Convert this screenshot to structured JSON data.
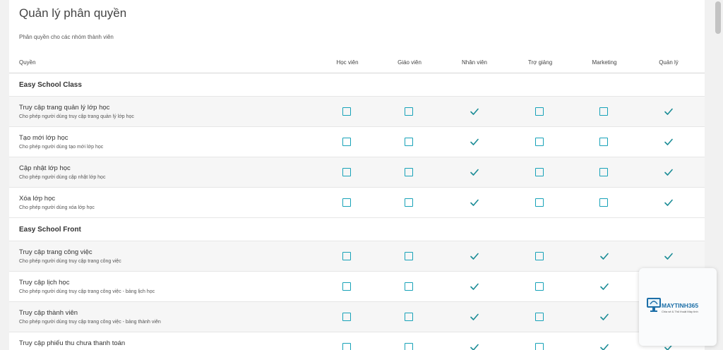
{
  "page": {
    "title": "Quản lý phân quyền",
    "subtitle": "Phân quyền cho các nhóm thành viên"
  },
  "table": {
    "permission_column": "Quyền",
    "roles": [
      "Học viên",
      "Giáo viên",
      "Nhân viên",
      "Trợ giảng",
      "Marketing",
      "Quản lý"
    ],
    "sections": [
      {
        "name": "Easy School Class",
        "items": [
          {
            "title": "Truy cập trang quản lý lớp học",
            "description": "Cho phép người dùng truy cập trang quản lý lớp học",
            "permissions": [
              false,
              false,
              true,
              false,
              false,
              true
            ]
          },
          {
            "title": "Tạo mới lớp học",
            "description": "Cho phép người dùng tạo mới lớp học",
            "permissions": [
              false,
              false,
              true,
              false,
              false,
              true
            ]
          },
          {
            "title": "Cập nhật lớp học",
            "description": "Cho phép người dùng cập nhật lớp học",
            "permissions": [
              false,
              false,
              true,
              false,
              false,
              true
            ]
          },
          {
            "title": "Xóa lớp học",
            "description": "Cho phép người dùng xóa lớp học",
            "permissions": [
              false,
              false,
              true,
              false,
              false,
              true
            ]
          }
        ]
      },
      {
        "name": "Easy School Front",
        "items": [
          {
            "title": "Truy cập trang công việc",
            "description": "Cho phép người dùng truy cập trang công việc",
            "permissions": [
              false,
              false,
              true,
              false,
              true,
              true
            ]
          },
          {
            "title": "Truy cập lịch học",
            "description": "Cho phép người dùng truy cập trang công việc - bảng lịch học",
            "permissions": [
              false,
              false,
              true,
              false,
              true,
              true
            ]
          },
          {
            "title": "Truy cập thành viên",
            "description": "Cho phép người dùng truy cập trang công việc - bảng thành viên",
            "permissions": [
              false,
              false,
              true,
              false,
              true,
              true
            ]
          },
          {
            "title": "Truy cập phiếu thu chưa thanh toán",
            "description": "",
            "permissions": [
              false,
              false,
              true,
              false,
              true,
              true
            ]
          }
        ]
      }
    ]
  },
  "watermark": {
    "brand": "MAYTINH365",
    "tagline": "Chia sẻ & Thủ thuật Máy tính"
  },
  "colors": {
    "accent": "#17a2b8",
    "check": "#1a8c96"
  }
}
